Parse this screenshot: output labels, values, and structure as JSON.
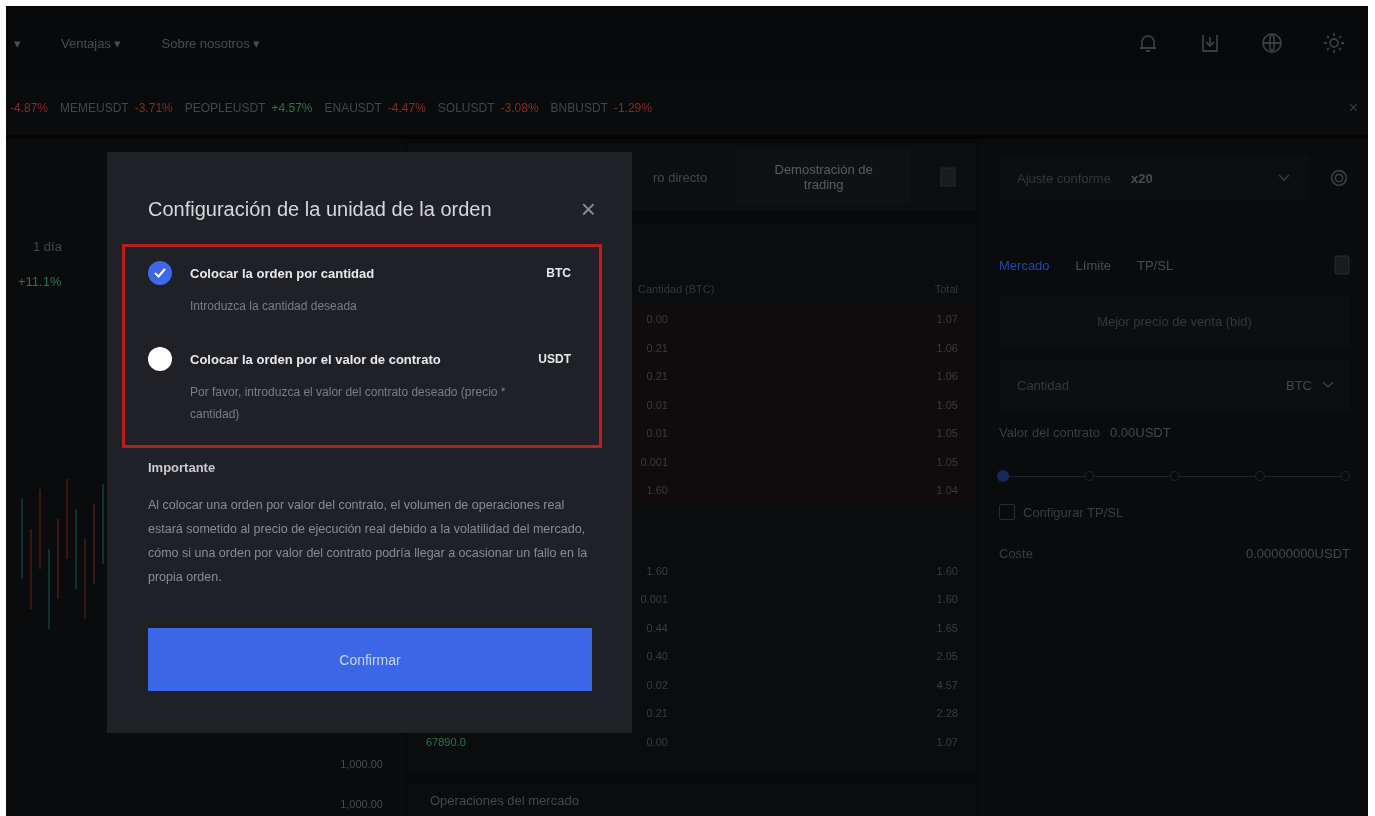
{
  "nav": {
    "menus": [
      {
        "label": "▾"
      },
      {
        "label": "Ventajas ▾"
      },
      {
        "label": "Sobre nosotros ▾"
      }
    ]
  },
  "ticker": {
    "items": [
      {
        "change": "-4.87%",
        "color": "#8a2a24"
      },
      {
        "symbol": "MEMEUSDT",
        "change": "-3.71%",
        "color": "#8a2a24"
      },
      {
        "symbol": "PEOPLEUSDT",
        "change": "+4.57%",
        "color": "#1f7a4a"
      },
      {
        "symbol": "ENAUSDT",
        "change": "-4.47%",
        "color": "#8a2a24"
      },
      {
        "symbol": "SOLUSDT",
        "change": "-3.08%",
        "color": "#8a2a24"
      },
      {
        "symbol": "BNBUSDT",
        "change": "-1.29%",
        "color": "#8a2a24"
      }
    ],
    "close": "×"
  },
  "chart": {
    "timeframe": "1 día",
    "change": "+11.1%",
    "price_labels": [
      "1,000.00",
      "1,000.00"
    ]
  },
  "trading_header": {
    "partial_label": "ro directo",
    "demo_button": "Demostración de trading"
  },
  "order_book": {
    "columns": [
      "Cantidad (BTC)",
      "Total"
    ],
    "asks": [
      {
        "quantity": "0.00",
        "total": "1.07"
      },
      {
        "quantity": "0.21",
        "total": "1.06"
      },
      {
        "quantity": "0.21",
        "total": "1.06"
      },
      {
        "quantity": "0.01",
        "total": "1.05"
      },
      {
        "quantity": "0.01",
        "total": "1.05"
      },
      {
        "quantity": "0.001",
        "total": "1.05"
      },
      {
        "quantity": "1.60",
        "total": "1.04"
      }
    ],
    "bids": [
      {
        "quantity": "1.60",
        "total": "1.60"
      },
      {
        "quantity": "0.001",
        "total": "1.60"
      },
      {
        "quantity": "0.44",
        "total": "1.65"
      },
      {
        "quantity": "0.40",
        "total": "2.05"
      },
      {
        "quantity": "0.02",
        "total": "4.57"
      },
      {
        "quantity": "0.21",
        "total": "2.28"
      },
      {
        "price": "67890.0",
        "quantity": "0.00",
        "total": "1.07"
      }
    ],
    "trades_title": "Operaciones del mercado"
  },
  "order_panel": {
    "leverage_label": "Ajuste conforme",
    "leverage_value": "x20",
    "tabs": [
      {
        "label": "Mercado",
        "selected": true
      },
      {
        "label": "Límite",
        "selected": false
      },
      {
        "label": "TP/SL",
        "selected": false
      }
    ],
    "price_field": "Mejor precio de venta (bid)",
    "quantity_placeholder": "Cantidad",
    "quantity_unit": "BTC",
    "contract_label": "Valor del contrato",
    "contract_value": "0.00USDT",
    "slider": {
      "level": 0
    },
    "tpsl": {
      "label": "Configurar TP/SL",
      "checked": false
    },
    "cost_label": "Coste",
    "cost_value": "0.00000000USDT"
  },
  "dialog": {
    "title": "Configuración de la unidad de la orden",
    "close": "×",
    "options": [
      {
        "title": "Colocar la orden por cantidad",
        "unit": "BTC",
        "description": "Introduzca la cantidad deseada",
        "selected": true
      },
      {
        "title": "Colocar la orden por el valor de contrato",
        "unit": "USDT",
        "description": "Por favor, introduzca el valor del contrato deseado (precio * cantidad)",
        "selected": false
      }
    ],
    "notice_title": "Importante",
    "notice_text": "Al colocar una orden por valor del contrato, el volumen de operaciones real estará sometido al precio de ejecución real debido a la volatilidad del mercado, cómo si una orden por valor del contrato podría llegar a ocasionar un fallo en la propia orden.",
    "confirm": "Confirmar"
  }
}
